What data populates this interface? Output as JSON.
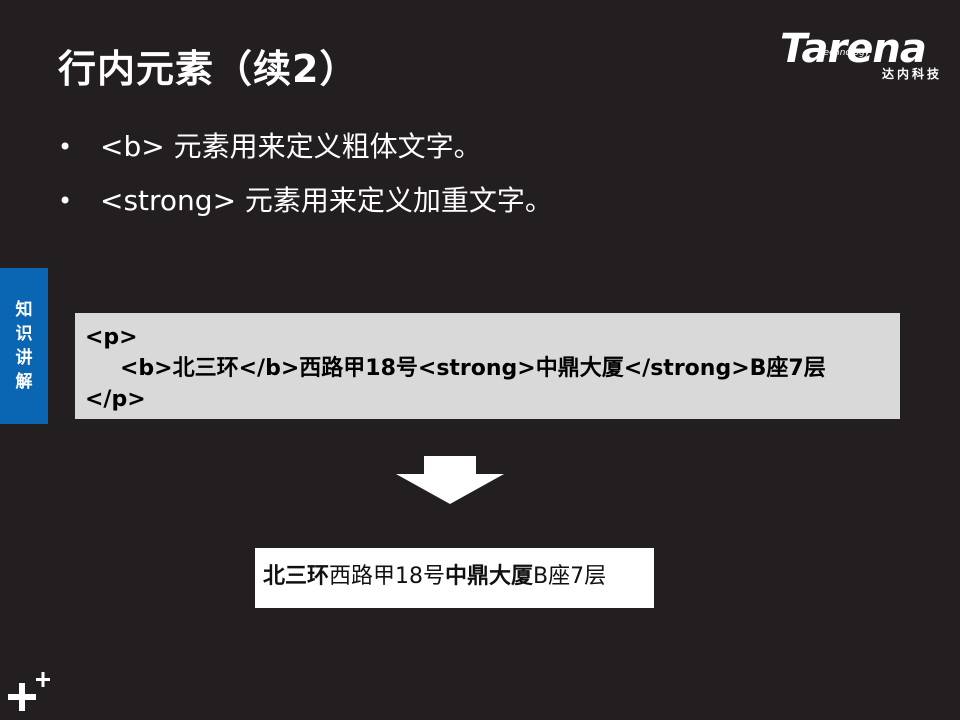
{
  "slide": {
    "title": "行内元素（续2）",
    "logo": {
      "sub": "Technology",
      "main": "Tarena",
      "cn": "达内科技"
    },
    "bullets": [
      "<b> 元素用来定义粗体文字。",
      "<strong> 元素用来定义加重文字。"
    ],
    "side_tab": {
      "chars": [
        "知",
        "识",
        "讲",
        "解"
      ]
    },
    "code": {
      "line1": "<p>",
      "line2": "<b>北三环</b>西路甲18号<strong>中鼎大厦</strong>B座7层",
      "line3": "</p>"
    },
    "result": {
      "bold_part": "北三环",
      "normal_part_1": "西路甲18号",
      "strong_part": "中鼎大厦",
      "normal_part_2": "B座7层"
    },
    "icons": {
      "arrow": "down-arrow-icon",
      "corner": "plus-icon"
    },
    "colors": {
      "background": "#231f20",
      "side_tab": "#0a66b3",
      "code_box": "#d9d9d9",
      "result_box": "#ffffff"
    }
  }
}
